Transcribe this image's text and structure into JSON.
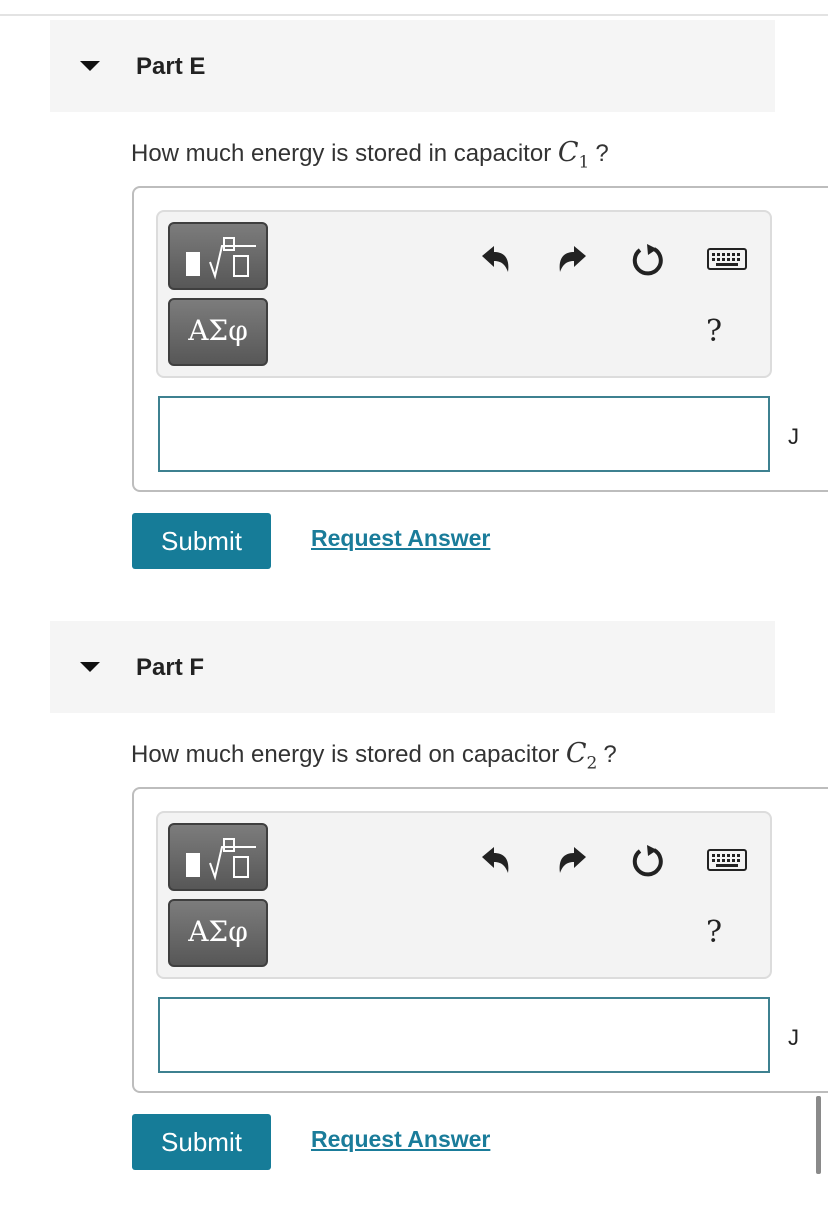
{
  "parts": [
    {
      "title": "Part E",
      "question_text": "How much energy is stored in capacitor ",
      "math_var": "C",
      "math_sub": "1",
      "question_suffix": "?",
      "unit": "J",
      "input_value": "",
      "symbols_label": "ΑΣφ",
      "help_label": "?",
      "submit_label": "Submit",
      "request_label": "Request Answer"
    },
    {
      "title": "Part F",
      "question_text": "How much energy is stored on capacitor ",
      "math_var": "C",
      "math_sub": "2",
      "question_suffix": "?",
      "unit": "J",
      "input_value": "",
      "symbols_label": "ΑΣφ",
      "help_label": "?",
      "submit_label": "Submit",
      "request_label": "Request Answer"
    }
  ],
  "icons": {
    "collapse": "caret-down-icon",
    "templates": "templates-icon",
    "undo": "undo-icon",
    "redo": "redo-icon",
    "reset": "reset-icon",
    "keyboard": "keyboard-icon"
  },
  "colors": {
    "submit_bg": "#167c98",
    "link": "#1a7c9a",
    "input_border": "#3e8190",
    "header_bg": "#f5f5f5"
  }
}
